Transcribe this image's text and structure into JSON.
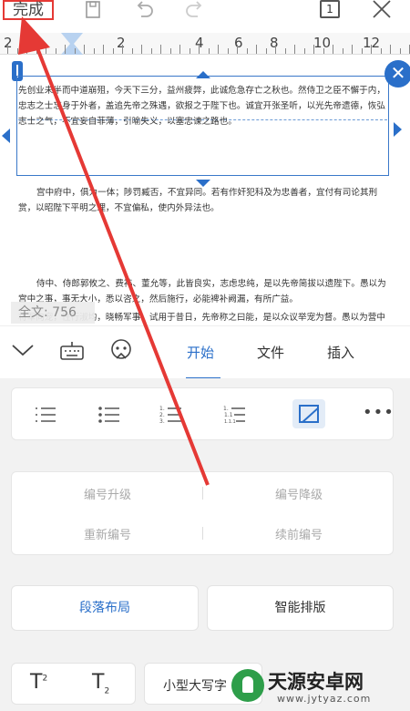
{
  "toolbar": {
    "done_label": "完成",
    "page_count": "1",
    "icons": [
      "save-icon",
      "undo-icon",
      "redo-icon",
      "page-count-icon",
      "close-icon"
    ]
  },
  "ruler": {
    "numbers": [
      "2",
      "2",
      "4",
      "6",
      "8",
      "10",
      "12"
    ]
  },
  "document": {
    "para1": "先创业未半而中道崩殂，今天下三分，益州疲弊，此诚危急存亡之秋也。然侍卫之臣不懈于内，忠志之士忘身于外者，盖追先帝之殊遇，欲报之于陛下也。诚宜开张圣听，以光先帝遗德，恢弘志士之气，不宜妄自菲薄，引喻失义，以塞忠谏之路也。",
    "para2": "宫中府中，俱为一体；陟罚臧否，不宜异同。若有作奸犯科及为忠善者，宜付有司论其刑赏，以昭陛下平明之理，不宜偏私，使内外异法也。",
    "para3": "侍中、侍郎郭攸之、费祎、董允等，此皆良实，志虑忠纯，是以先帝简拔以遗陛下。愚以为宫中之事，事无大小，悉以咨之，然后施行，必能裨补阙漏，有所广益。",
    "para4": "将军向宠，性行淑均，晓畅军事，试用于昔日，先帝称之曰能，是以众议举宠为督。愚以为营中之事，悉以咨之，必能使行阵和睦，优劣得所。",
    "word_count": "全文: 756"
  },
  "tabs": {
    "start": "开始",
    "file": "文件",
    "insert": "插入"
  },
  "numbering": {
    "promote": "编号升级",
    "demote": "编号降级",
    "restart": "重新编号",
    "continue": "续前编号"
  },
  "buttons": {
    "paragraph_layout": "段落布局",
    "smart_layout": "智能排版"
  },
  "format": {
    "superscript_base": "T",
    "superscript_mark": "2",
    "subscript_base": "T",
    "subscript_mark": "2",
    "small_caps": "小型大写字"
  },
  "watermark": {
    "title": "天源安卓网",
    "url": "www.jytyaz.com"
  },
  "colors": {
    "accent": "#2a6fc9",
    "annotation_red": "#e53935"
  }
}
